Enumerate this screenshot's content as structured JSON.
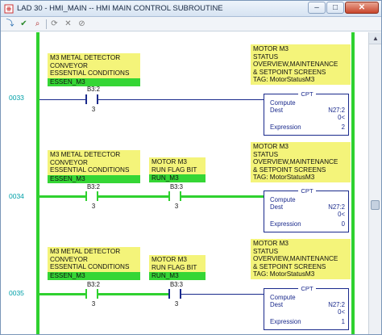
{
  "window": {
    "title": "LAD 30 - HMI_MAIN -- HMI MAIN CONTROL SUBROUTINE",
    "minimize": "–",
    "maximize": "□",
    "close": "✕"
  },
  "toolbar": {
    "icons": [
      "goto-rung-icon",
      "verify-icon",
      "find-icon",
      "refresh-icon",
      "cancel-icon",
      "accept-icon"
    ]
  },
  "colors": {
    "rail": "#2fd12f",
    "wire": "#1a2a8c",
    "description_bg": "#f4f47a",
    "energized_bg": "#35d635",
    "rung_number": "#00a0a8"
  },
  "rungs": [
    {
      "number": "0033",
      "contacts": [
        {
          "description": [
            "M3 METAL DETECTOR",
            "CONVEYOR",
            "ESSENTIAL CONDITIONS"
          ],
          "symbol": "ESSEN_M3",
          "address": "B3:2",
          "bit": "3",
          "energized": false
        }
      ],
      "output": {
        "description": [
          "MOTOR M3",
          "STATUS",
          "OVERVIEW,MAINTENANCE",
          "& SETPOINT SCREENS",
          "TAG: MotorStatusM3"
        ],
        "header": "CPT",
        "compute": "Compute",
        "dest_label": "Dest",
        "dest": "N27:2",
        "dest_value": "0<",
        "expr_label": "Expression",
        "expression": "2"
      }
    },
    {
      "number": "0034",
      "contacts": [
        {
          "description": [
            "M3 METAL DETECTOR",
            "CONVEYOR",
            "ESSENTIAL CONDITIONS"
          ],
          "symbol": "ESSEN_M3",
          "address": "B3:2",
          "bit": "3",
          "energized": true
        },
        {
          "description": [
            "MOTOR M3",
            "RUN FLAG BIT"
          ],
          "symbol": "RUN_M3",
          "address": "B3:3",
          "bit": "3",
          "energized": true
        }
      ],
      "output": {
        "description": [
          "MOTOR M3",
          "STATUS",
          "OVERVIEW,MAINTENANCE",
          "& SETPOINT SCREENS",
          "TAG: MotorStatusM3"
        ],
        "header": "CPT",
        "compute": "Compute",
        "dest_label": "Dest",
        "dest": "N27:2",
        "dest_value": "0<",
        "expr_label": "Expression",
        "expression": "0"
      }
    },
    {
      "number": "0035",
      "contacts": [
        {
          "description": [
            "M3 METAL DETECTOR",
            "CONVEYOR",
            "ESSENTIAL CONDITIONS"
          ],
          "symbol": "ESSEN_M3",
          "address": "B3:2",
          "bit": "3",
          "energized": true
        },
        {
          "description": [
            "MOTOR M3",
            "RUN FLAG BIT"
          ],
          "symbol": "RUN_M3",
          "address": "B3:3",
          "bit": "3",
          "energized": false
        }
      ],
      "output": {
        "description": [
          "MOTOR M3",
          "STATUS",
          "OVERVIEW,MAINTENANCE",
          "& SETPOINT SCREENS",
          "TAG: MotorStatusM3"
        ],
        "header": "CPT",
        "compute": "Compute",
        "dest_label": "Dest",
        "dest": "N27:2",
        "dest_value": "0<",
        "expr_label": "Expression",
        "expression": "1"
      }
    }
  ],
  "scrollbar": {
    "up": "▲",
    "down": "▼"
  }
}
